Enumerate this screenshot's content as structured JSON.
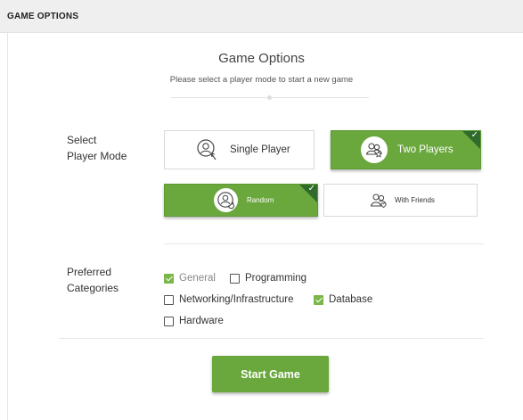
{
  "header": {
    "title": "GAME OPTIONS"
  },
  "main": {
    "title": "Game Options",
    "subtitle": "Please select a player mode to start a new game"
  },
  "player_mode": {
    "label_line1": "Select",
    "label_line2": "Player Mode",
    "options": [
      {
        "label": "Single Player",
        "icon": "single-player-icon",
        "selected": false
      },
      {
        "label": "Two Players",
        "icon": "two-players-icon",
        "selected": true
      },
      {
        "label": "Random",
        "icon": "random-icon",
        "selected": true
      },
      {
        "label": "With Friends",
        "icon": "with-friends-icon",
        "selected": false
      }
    ],
    "check_glyph": "✓"
  },
  "categories": {
    "label_line1": "Preferred",
    "label_line2": "Categories",
    "items": [
      {
        "label": "General",
        "checked": true,
        "disabled": true
      },
      {
        "label": "Programming",
        "checked": false,
        "disabled": false
      },
      {
        "label": "Networking/Infrastructure",
        "checked": false,
        "disabled": false
      },
      {
        "label": "Database",
        "checked": true,
        "disabled": false
      },
      {
        "label": "Hardware",
        "checked": false,
        "disabled": false
      }
    ]
  },
  "actions": {
    "start_label": "Start Game"
  },
  "colors": {
    "accent": "#6aa73c",
    "corner": "#2f6b2a",
    "checkbox": "#7ab648",
    "header_bg": "#efefef"
  }
}
